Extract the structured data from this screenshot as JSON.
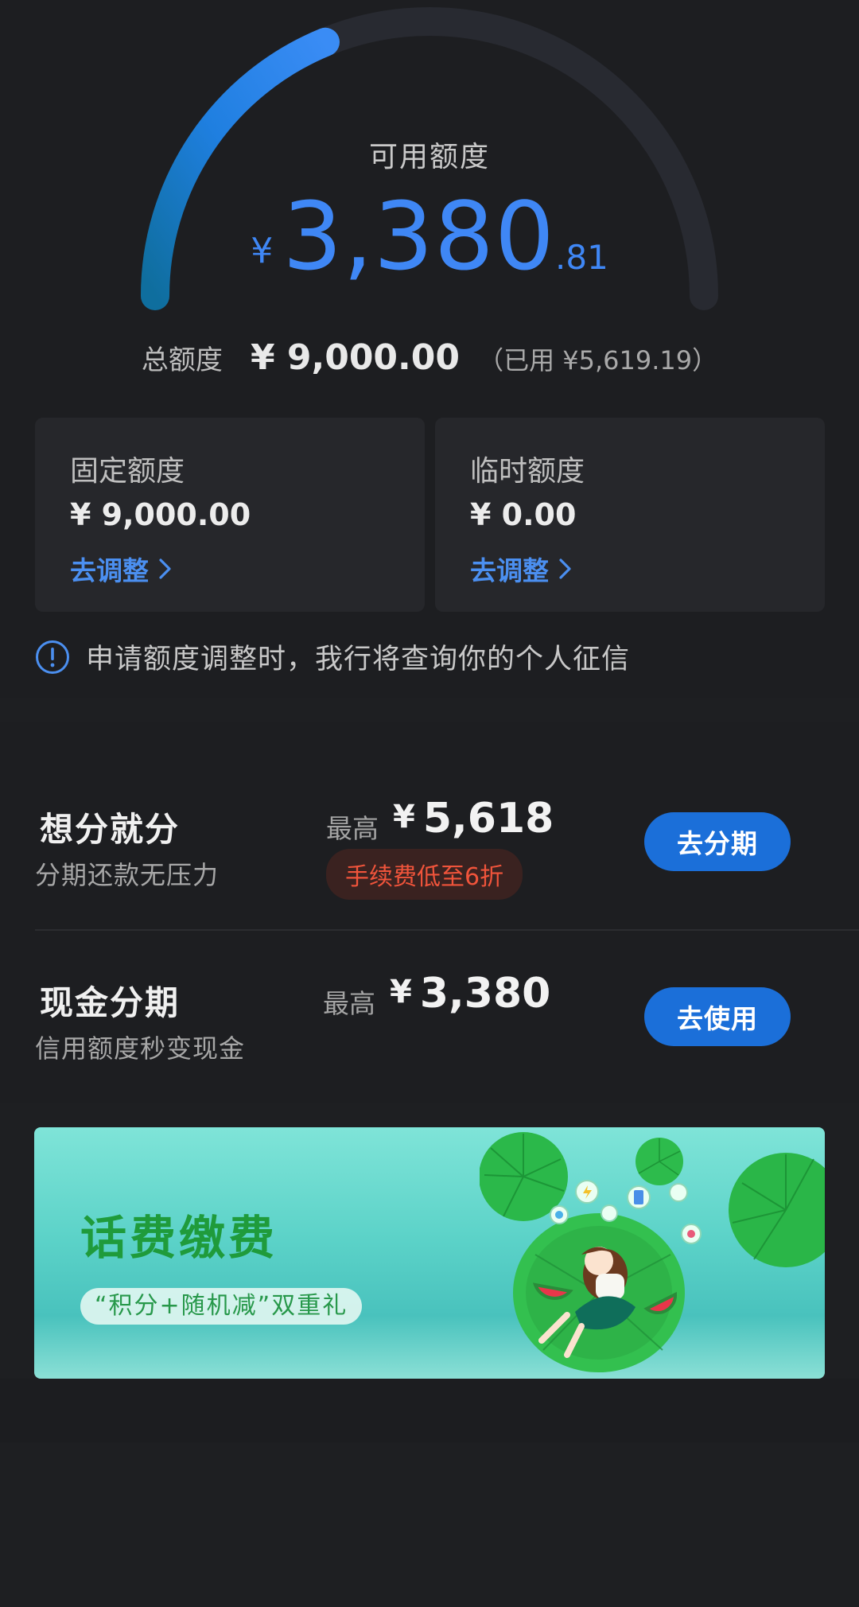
{
  "credit": {
    "available_label": "可用额度",
    "currency_symbol": "¥",
    "available_integer": "3,380",
    "available_decimal": ".81",
    "gauge_used_fraction": 0.376,
    "total_label": "总额度",
    "total_value": "¥ 9,000.00",
    "used_text": "（已用 ¥5,619.19）"
  },
  "cards": [
    {
      "title": "固定额度",
      "amount": "¥ 9,000.00",
      "action": "去调整"
    },
    {
      "title": "临时额度",
      "amount": "¥ 0.00",
      "action": "去调整"
    }
  ],
  "notice": "申请额度调整时，我行将查询你的个人征信",
  "installments": [
    {
      "name": "想分就分",
      "desc": "分期还款无压力",
      "max_label": "最高",
      "currency": "¥",
      "max_value": "5,618",
      "badge": "手续费低至6折",
      "button": "去分期"
    },
    {
      "name": "现金分期",
      "desc": "信用额度秒变现金",
      "max_label": "最高",
      "currency": "¥",
      "max_value": "3,380",
      "button": "去使用"
    }
  ],
  "banner": {
    "title": "话费缴费",
    "subtitle": "“积分+随机减”双重礼"
  },
  "colors": {
    "accent_blue": "#3f87f5",
    "button_blue": "#1b6fd9",
    "badge_red": "#f0543b",
    "background": "#1d1e21",
    "card_bg": "#26272b"
  }
}
